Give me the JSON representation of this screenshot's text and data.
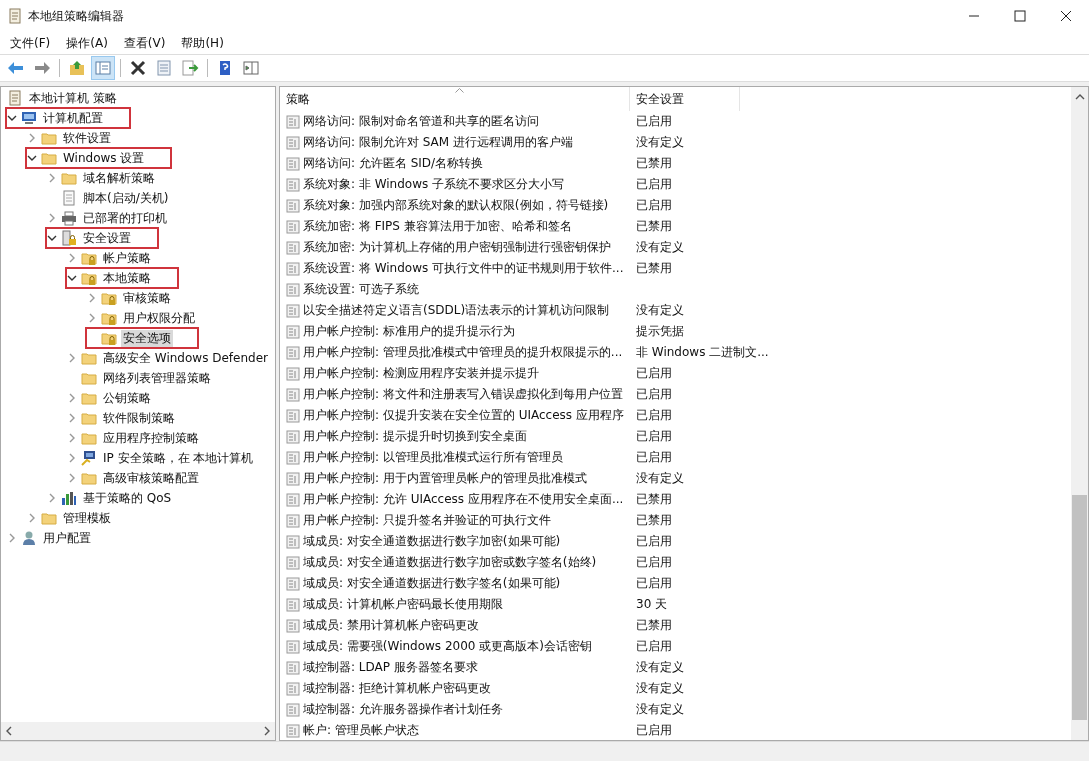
{
  "window": {
    "title": "本地组策略编辑器"
  },
  "menu": [
    "文件(F)",
    "操作(A)",
    "查看(V)",
    "帮助(H)"
  ],
  "toolbar_buttons": [
    {
      "pressed": false
    },
    {
      "pressed": false
    },
    {
      "pressed": false
    },
    {
      "pressed": true
    },
    {
      "pressed": false
    },
    {
      "pressed": false
    },
    {
      "pressed": false
    },
    {
      "pressed": false
    },
    {
      "pressed": false
    }
  ],
  "tree": [
    {
      "label": "本地计算机 策略",
      "kind": "policy",
      "selected": false,
      "marked": false,
      "children": [
        {
          "label": "计算机配置",
          "kind": "computer",
          "expandable": true,
          "expanded": true,
          "selected": false,
          "marked": true,
          "children": [
            {
              "label": "软件设置",
              "kind": "folder",
              "expandable": true,
              "expanded": false,
              "selected": false,
              "marked": false
            },
            {
              "label": "Windows 设置",
              "kind": "folder",
              "expandable": true,
              "expanded": true,
              "selected": false,
              "marked": true,
              "children": [
                {
                  "label": "域名解析策略",
                  "kind": "folder",
                  "expandable": true,
                  "expanded": false,
                  "selected": false,
                  "marked": false
                },
                {
                  "label": "脚本(启动/关机)",
                  "kind": "script",
                  "expandable": false,
                  "expanded": false,
                  "selected": false,
                  "marked": false
                },
                {
                  "label": "已部署的打印机",
                  "kind": "printer",
                  "expandable": true,
                  "expanded": false,
                  "selected": false,
                  "marked": false
                },
                {
                  "label": "安全设置",
                  "kind": "secure",
                  "expandable": true,
                  "expanded": true,
                  "selected": false,
                  "marked": true,
                  "children": [
                    {
                      "label": "帐户策略",
                      "kind": "lock-folder",
                      "expandable": true,
                      "expanded": false,
                      "selected": false,
                      "marked": false
                    },
                    {
                      "label": "本地策略",
                      "kind": "lock-folder",
                      "expandable": true,
                      "expanded": true,
                      "selected": false,
                      "marked": true,
                      "children": [
                        {
                          "label": "审核策略",
                          "kind": "lock-folder",
                          "expandable": true,
                          "expanded": false,
                          "selected": false,
                          "marked": false
                        },
                        {
                          "label": "用户权限分配",
                          "kind": "lock-folder",
                          "expandable": true,
                          "expanded": false,
                          "selected": false,
                          "marked": false
                        },
                        {
                          "label": "安全选项",
                          "kind": "lock-folder",
                          "expandable": false,
                          "expanded": false,
                          "selected": true,
                          "marked": true
                        }
                      ]
                    },
                    {
                      "label": "高级安全 Windows Defender",
                      "kind": "folder",
                      "expandable": true,
                      "expanded": false,
                      "selected": false,
                      "marked": false
                    },
                    {
                      "label": "网络列表管理器策略",
                      "kind": "folder",
                      "expandable": false,
                      "expanded": false,
                      "selected": false,
                      "marked": false
                    },
                    {
                      "label": "公钥策略",
                      "kind": "folder",
                      "expandable": true,
                      "expanded": false,
                      "selected": false,
                      "marked": false
                    },
                    {
                      "label": "软件限制策略",
                      "kind": "folder",
                      "expandable": true,
                      "expanded": false,
                      "selected": false,
                      "marked": false
                    },
                    {
                      "label": "应用程序控制策略",
                      "kind": "folder",
                      "expandable": true,
                      "expanded": false,
                      "selected": false,
                      "marked": false
                    },
                    {
                      "label": "IP 安全策略，在 本地计算机",
                      "kind": "ip",
                      "expandable": true,
                      "expanded": false,
                      "selected": false,
                      "marked": false
                    },
                    {
                      "label": "高级审核策略配置",
                      "kind": "folder",
                      "expandable": true,
                      "expanded": false,
                      "selected": false,
                      "marked": false
                    }
                  ]
                },
                {
                  "label": "基于策略的 QoS",
                  "kind": "chart",
                  "expandable": true,
                  "expanded": false,
                  "selected": false,
                  "marked": false
                }
              ]
            },
            {
              "label": "管理模板",
              "kind": "folder",
              "expandable": true,
              "expanded": false,
              "selected": false,
              "marked": false
            }
          ]
        },
        {
          "label": "用户配置",
          "kind": "user",
          "expandable": true,
          "expanded": false,
          "selected": false,
          "marked": false
        }
      ]
    }
  ],
  "table": {
    "columns": [
      {
        "label": "策略",
        "sorted": true
      },
      {
        "label": "安全设置"
      }
    ],
    "rows": [
      {
        "policy": "网络访问: 限制对命名管道和共享的匿名访问",
        "setting": "已启用"
      },
      {
        "policy": "网络访问: 限制允许对 SAM 进行远程调用的客户端",
        "setting": "没有定义"
      },
      {
        "policy": "网络访问: 允许匿名 SID/名称转换",
        "setting": "已禁用"
      },
      {
        "policy": "系统对象: 非 Windows 子系统不要求区分大小写",
        "setting": "已启用"
      },
      {
        "policy": "系统对象: 加强内部系统对象的默认权限(例如，符号链接)",
        "setting": "已启用"
      },
      {
        "policy": "系统加密: 将 FIPS 兼容算法用于加密、哈希和签名",
        "setting": "已禁用"
      },
      {
        "policy": "系统加密: 为计算机上存储的用户密钥强制进行强密钥保护",
        "setting": "没有定义"
      },
      {
        "policy": "系统设置: 将 Windows 可执行文件中的证书规则用于软件...",
        "setting": "已禁用"
      },
      {
        "policy": "系统设置: 可选子系统"
      },
      {
        "policy": "以安全描述符定义语言(SDDL)语法表示的计算机访问限制",
        "setting": "没有定义"
      },
      {
        "policy": "用户帐户控制: 标准用户的提升提示行为",
        "setting": "提示凭据"
      },
      {
        "policy": "用户帐户控制: 管理员批准模式中管理员的提升权限提示的...",
        "setting": "非 Windows 二进制文..."
      },
      {
        "policy": "用户帐户控制: 检测应用程序安装并提示提升",
        "setting": "已启用"
      },
      {
        "policy": "用户帐户控制: 将文件和注册表写入错误虚拟化到每用户位置",
        "setting": "已启用"
      },
      {
        "policy": "用户帐户控制: 仅提升安装在安全位置的 UIAccess 应用程序",
        "setting": "已启用"
      },
      {
        "policy": "用户帐户控制: 提示提升时切换到安全桌面",
        "setting": "已启用"
      },
      {
        "policy": "用户帐户控制: 以管理员批准模式运行所有管理员",
        "setting": "已启用"
      },
      {
        "policy": "用户帐户控制: 用于内置管理员帐户的管理员批准模式",
        "setting": "没有定义"
      },
      {
        "policy": "用户帐户控制: 允许 UIAccess 应用程序在不使用安全桌面...",
        "setting": "已禁用"
      },
      {
        "policy": "用户帐户控制: 只提升签名并验证的可执行文件",
        "setting": "已禁用"
      },
      {
        "policy": "域成员: 对安全通道数据进行数字加密(如果可能)",
        "setting": "已启用"
      },
      {
        "policy": "域成员: 对安全通道数据进行数字加密或数字签名(始终)",
        "setting": "已启用"
      },
      {
        "policy": "域成员: 对安全通道数据进行数字签名(如果可能)",
        "setting": "已启用"
      },
      {
        "policy": "域成员: 计算机帐户密码最长使用期限",
        "setting": "30 天"
      },
      {
        "policy": "域成员: 禁用计算机帐户密码更改",
        "setting": "已禁用"
      },
      {
        "policy": "域成员: 需要强(Windows 2000 或更高版本)会话密钥",
        "setting": "已启用"
      },
      {
        "policy": "域控制器: LDAP 服务器签名要求",
        "setting": "没有定义"
      },
      {
        "policy": "域控制器: 拒绝计算机帐户密码更改",
        "setting": "没有定义"
      },
      {
        "policy": "域控制器: 允许服务器操作者计划任务",
        "setting": "没有定义"
      },
      {
        "policy": "帐户: 管理员帐户状态",
        "setting": "已启用"
      }
    ]
  }
}
